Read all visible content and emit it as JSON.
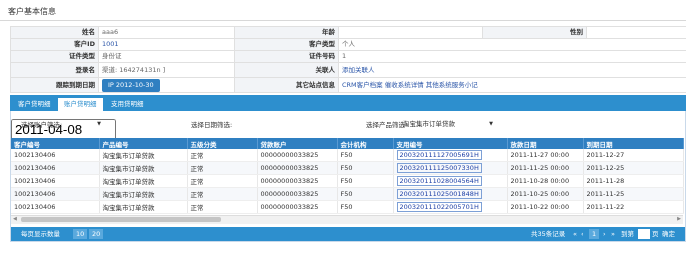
{
  "header": {
    "title": "客户基本信息"
  },
  "info": {
    "row1": {
      "name_label": "姓名",
      "name_value": "aaa6",
      "age_label": "年龄",
      "age_value": "",
      "gender_label": "性别",
      "gender_value": ""
    },
    "row2": {
      "client_id_label": "客户ID",
      "client_id_value": "1001",
      "client_type_label": "客户类型",
      "client_type_value": "个人"
    },
    "row3": {
      "id_type_label": "证件类型",
      "id_type_value": "身份证",
      "id_no_label": "证件号码",
      "id_no_value": "1"
    },
    "row4": {
      "login_label": "登录名",
      "login_value": "渠道: 164274131n ]",
      "contact_label": "关联人",
      "contact_value": "添加关联人"
    },
    "row5": {
      "followup_label": "跟踪到期日期",
      "followup_value": "IP 2012-10-30",
      "other_label": "其它站点信息",
      "other_value": "CRM客户档案 催收系统详情 其他系统服务小记"
    }
  },
  "tabs": [
    "客户贷明细",
    "账户贷明细",
    "支用贷明细"
  ],
  "filters": {
    "account_label": "选择账户筛选:",
    "date_label": "选择日期筛选:",
    "date_value": "2011-04-08",
    "product_label": "选择产品筛选:",
    "product_value": "淘宝集市订单贷款"
  },
  "table": {
    "headers": [
      "客户编号",
      "产品编号",
      "五级分类",
      "贷款账户",
      "会计机构",
      "支用编号",
      "放款日期",
      "到期日期"
    ],
    "rows": [
      [
        "1002130406",
        "淘宝集市订单贷款",
        "正常",
        "00000000033825",
        "F50",
        "200320111127005691H",
        "2011-11-27 00:00",
        "2011-12-27"
      ],
      [
        "1002130406",
        "淘宝集市订单贷款",
        "正常",
        "00000000033825",
        "F50",
        "200320111125007330H",
        "2011-11-25 00:00",
        "2011-12-25"
      ],
      [
        "1002130406",
        "淘宝集市订单贷款",
        "正常",
        "00000000033825",
        "F50",
        "200320111028004564H",
        "2011-10-28 00:00",
        "2011-11-28"
      ],
      [
        "1002130406",
        "淘宝集市订单贷款",
        "正常",
        "00000000033825",
        "F50",
        "200320111025001848H",
        "2011-10-25 00:00",
        "2011-11-25"
      ],
      [
        "1002130406",
        "淘宝集市订单贷款",
        "正常",
        "00000000033825",
        "F50",
        "200320111022005701H",
        "2011-10-22 00:00",
        "2011-11-22"
      ]
    ]
  },
  "pager": {
    "per_page_label": "每页显示数量",
    "sizes": [
      "10",
      "20"
    ],
    "total": "共35条记录",
    "first": "«",
    "prev": "‹",
    "page": "1",
    "next": "›",
    "last": "»",
    "goto_label": "到第",
    "page_unit": "页",
    "confirm": "确定"
  }
}
